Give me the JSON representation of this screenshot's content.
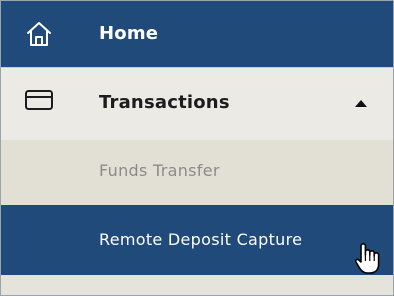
{
  "nav": {
    "home": {
      "label": "Home",
      "icon": "home-icon"
    },
    "transactions": {
      "label": "Transactions",
      "icon": "card-icon",
      "expanded": true,
      "caret": "caret-up-icon",
      "children": [
        {
          "label": "Funds Transfer"
        },
        {
          "label": "Remote Deposit Capture"
        }
      ]
    }
  },
  "colors": {
    "navy": "#1f4a7a",
    "expanded_bg": "#eceae4",
    "submenu_bg": "#e2dfd5",
    "muted_text": "#8b8b8b"
  },
  "cursor": "hand-pointer-icon"
}
